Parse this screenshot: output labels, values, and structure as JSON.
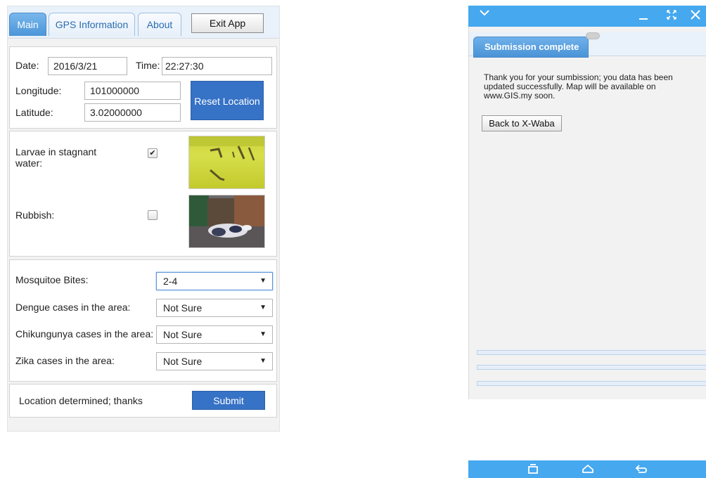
{
  "left": {
    "tabs": [
      {
        "label": "Main"
      },
      {
        "label": "GPS Information"
      },
      {
        "label": "About"
      }
    ],
    "exit_label": "Exit App",
    "location": {
      "date_label": "Date:",
      "date_value": "2016/3/21",
      "time_label": "Time:",
      "time_value": "22:27:30",
      "longitude_label": "Longitude:",
      "longitude_value": "101000000",
      "latitude_label": "Latitude:",
      "latitude_value": "3.02000000",
      "reset_label": "Reset Location"
    },
    "observations": [
      {
        "label": "Larvae in stagnant water:",
        "checked": true,
        "photo": "larvae-photo"
      },
      {
        "label": "Rubbish:",
        "checked": false,
        "photo": "rubbish-photo"
      }
    ],
    "survey": [
      {
        "label": "Mosquitoe Bites:",
        "value": "2-4"
      },
      {
        "label": "Dengue cases in the area:",
        "value": "Not Sure"
      },
      {
        "label": "Chikungunya cases in the area:",
        "value": "Not Sure"
      },
      {
        "label": "Zika cases in the area:",
        "value": "Not Sure"
      }
    ],
    "check_mark": "✔",
    "dropdown_arrow": "▼",
    "status_text": "Location determined; thanks",
    "submit_label": "Submit"
  },
  "right": {
    "titlebar_icons": [
      "chevron-down-icon",
      "minimize-icon",
      "fullscreen-icon",
      "close-icon"
    ],
    "tab_label": "Submission complete",
    "message": "Thank you for your sumbission; you data has been updated successfully. Map will be available on www.GIS.my soon.",
    "back_label": "Back to X-Waba",
    "nav_icons": [
      "recent-apps-icon",
      "home-icon",
      "back-icon"
    ]
  },
  "colors": {
    "accent_blue": "#3672c6",
    "tab_blue": "#4b95d8",
    "android_bar": "#46a8ef"
  }
}
